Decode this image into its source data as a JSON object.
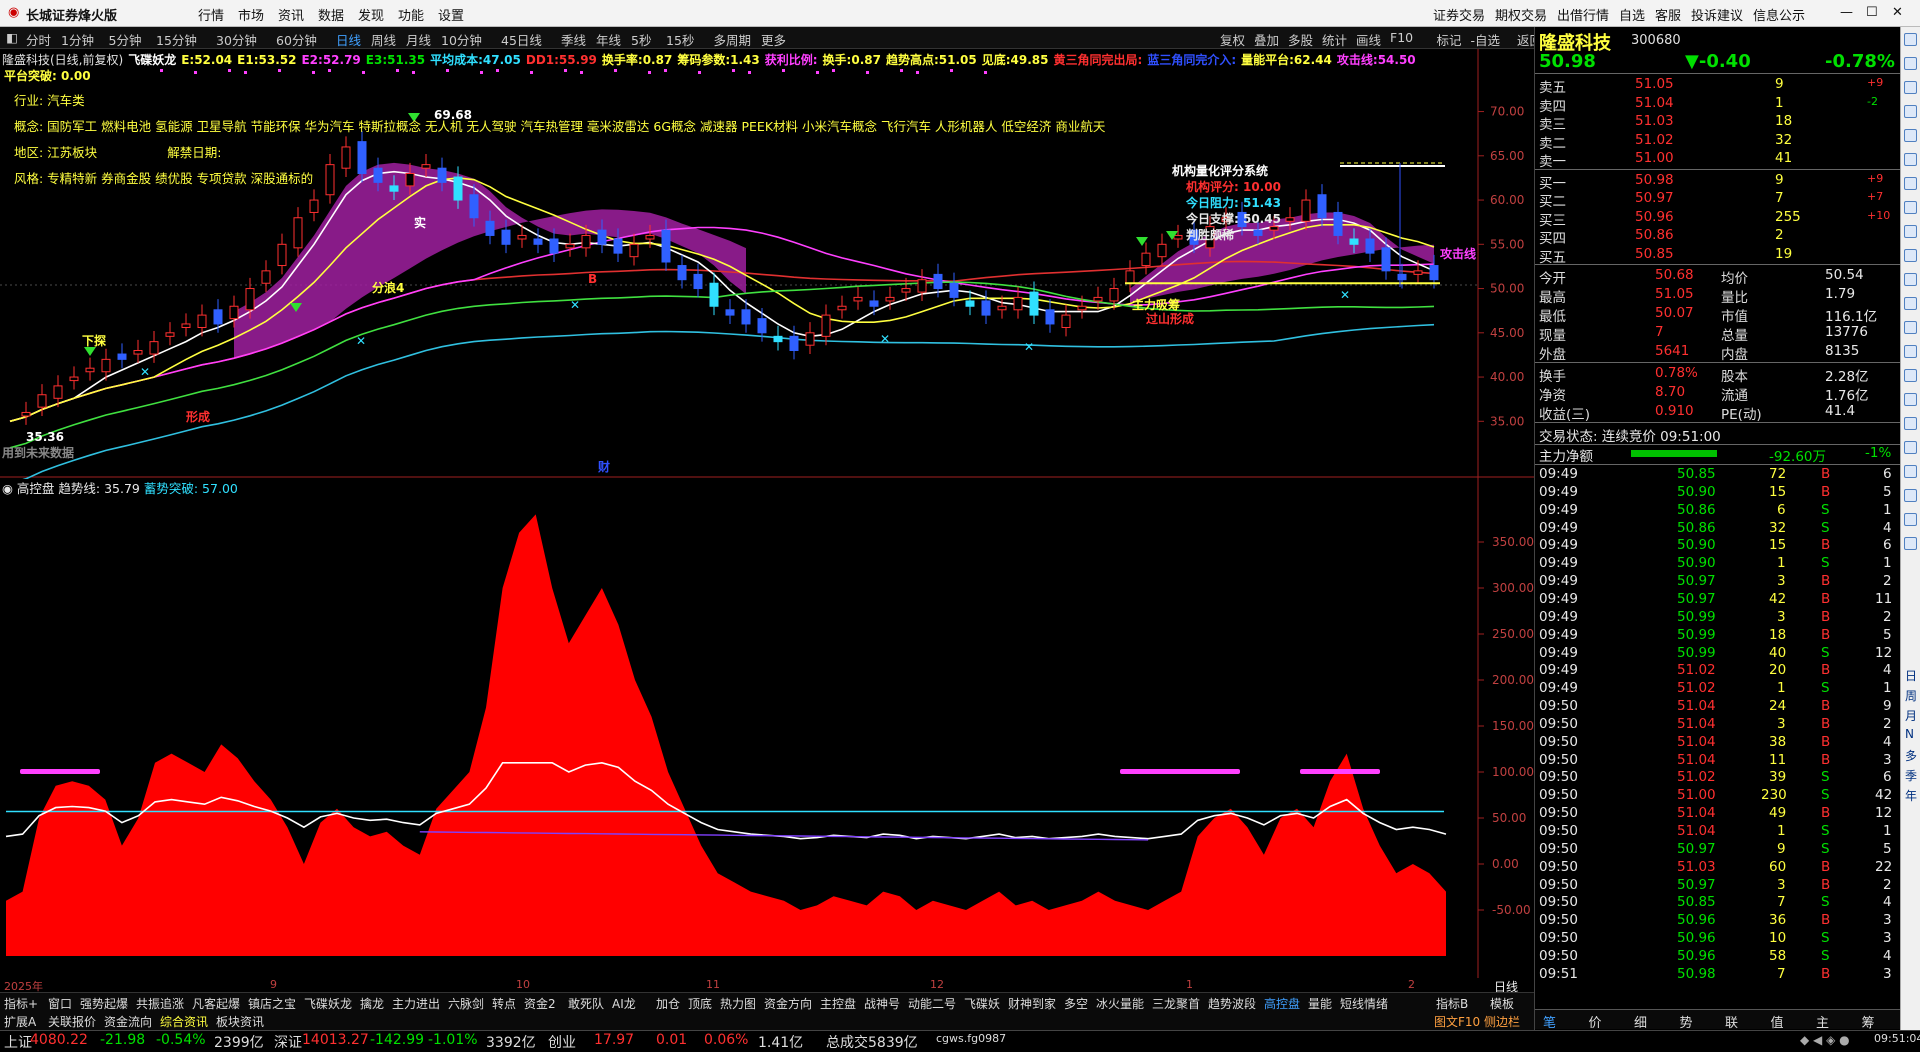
{
  "app": {
    "title": "长城证券烽火版",
    "menus": [
      "行情",
      "市场",
      "资讯",
      "数据",
      "发现",
      "功能",
      "设置"
    ],
    "right_menus": [
      "证券交易",
      "期权交易",
      "出借行情",
      "自选",
      "客服",
      "投诉建议",
      "信息公示"
    ]
  },
  "periods": [
    "分时",
    "1分钟",
    "5分钟",
    "15分钟",
    "30分钟",
    "60分钟",
    "日线",
    "周线",
    "月线",
    "10分钟",
    "45日线",
    "季线",
    "年线",
    "5秒",
    "15秒",
    "多周期",
    "更多"
  ],
  "active_period": "日线",
  "right_tools": [
    "复权",
    "叠加",
    "多股",
    "统计",
    "画线",
    "F10",
    "标记",
    "-自选",
    "返回"
  ],
  "main_header": {
    "line1": [
      {
        "t": "隆盛科技(日线,前复权)",
        "c": "#e0e0e0"
      },
      {
        "t": "飞碟妖龙",
        "c": "#ffffff"
      },
      {
        "t": "E:52.04",
        "c": "#ffff40"
      },
      {
        "t": "E1:53.52",
        "c": "#ffff40"
      },
      {
        "t": "E2:52.79",
        "c": "#ff40ff"
      },
      {
        "t": "E3:51.35",
        "c": "#00e000"
      },
      {
        "t": "平均成本:47.05",
        "c": "#30e0ff"
      },
      {
        "t": "DD1:55.99",
        "c": "#ff3030"
      },
      {
        "t": "换手率:0.87",
        "c": "#ffff40"
      },
      {
        "t": "筹码参数:1.43",
        "c": "#ffff40"
      },
      {
        "t": "获利比例:",
        "c": "#ff40ff"
      },
      {
        "t": "换手:0.87",
        "c": "#ffff40"
      },
      {
        "t": "趋势高点:51.05",
        "c": "#ffff40"
      },
      {
        "t": "见底:49.85",
        "c": "#ffff40"
      },
      {
        "t": "黄三角同完出局:",
        "c": "#ff3030"
      },
      {
        "t": "蓝三角同完介入:",
        "c": "#3050ff"
      },
      {
        "t": "量能平台:62.44",
        "c": "#ffff40"
      },
      {
        "t": "攻击线:54.50",
        "c": "#ff40ff"
      }
    ],
    "line2": "平台突破: 0.00"
  },
  "info": {
    "industry": "行业: 汽车类",
    "concept": "概念: 国防军工 燃料电池 氢能源 卫星导航 节能环保 华为汽车 特斯拉概念 无人机 无人驾驶 汽车热管理 毫米波雷达 6G概念 减速器 PEEK材料 小米汽车概念 飞行汽车 人形机器人 低空经济 商业航天",
    "region": "地区: 江苏板块",
    "unban": "解禁日期:",
    "style": "风格: 专精特新 券商金股 绩优股 专项贷款 深股通标的"
  },
  "chart_labels": {
    "high": "69.68",
    "low": "35.36",
    "future": "用到未来数据",
    "cai": "财",
    "attack": "攻击线",
    "box_title": "机构量化评分系统",
    "box_score": "机构评分: 10.00",
    "box_res": "今日阻力: 51.43",
    "box_sup": "今日支撑: 50.45",
    "box_judge": "判胜颇稀",
    "zhuli": "主力吸筹",
    "guoshan": "过山形成",
    "fenlang": "分浪4",
    "yi1": "形成",
    "buy_b": "B",
    "xiapo": "下探",
    "shi": "实"
  },
  "ind_header": {
    "name": "高控盘",
    "trend": "趋势线: 35.79",
    "breakout": "蓄势突破: 57.00"
  },
  "price_axis": [
    "70.00",
    "65.00",
    "60.00",
    "55.00",
    "50.00",
    "45.00",
    "40.00",
    "35.00"
  ],
  "ind_axis": [
    "350.00",
    "300.00",
    "250.00",
    "200.00",
    "150.00",
    "100.00",
    "50.00",
    "0.00",
    "-50.00"
  ],
  "date_labels": [
    "2025年",
    "9",
    "10",
    "11",
    "12",
    "1",
    "2"
  ],
  "period_label": "日线",
  "bottom_tabs": [
    "指标+",
    "窗口",
    "强势起爆",
    "共振追涨",
    "凡客起爆",
    "镇店之宝",
    "飞碟妖龙",
    "擒龙",
    "主力进出",
    "六脉剑",
    "转点",
    "资金2",
    "敢死队",
    "AI龙",
    "加仓",
    "顶底",
    "热力图",
    "资金方向",
    "主控盘",
    "战神号",
    "动能二号",
    "飞碟妖",
    "财神到家",
    "多空",
    "冰火量能",
    "三龙聚首",
    "趋势波段",
    "高控盘",
    "量能",
    "短线情绪"
  ],
  "bottom_tabs2": [
    "扩展A",
    "关联报价",
    "资金流向",
    "综合资讯",
    "板块资讯"
  ],
  "bottom_right": [
    "指标B",
    "模板",
    "图文F10 侧边栏"
  ],
  "quote": {
    "name": "隆盛科技",
    "code": "300680",
    "price": "50.98",
    "change": "▼-0.40",
    "pct": "-0.78%",
    "asks": [
      [
        "卖五",
        "51.05",
        "9",
        "+9"
      ],
      [
        "卖四",
        "51.04",
        "1",
        "-2"
      ],
      [
        "卖三",
        "51.03",
        "18",
        ""
      ],
      [
        "卖二",
        "51.02",
        "32",
        ""
      ],
      [
        "卖一",
        "51.00",
        "41",
        ""
      ]
    ],
    "bids": [
      [
        "买一",
        "50.98",
        "9",
        "+9"
      ],
      [
        "买二",
        "50.97",
        "7",
        "+7"
      ],
      [
        "买三",
        "50.96",
        "255",
        "+10"
      ],
      [
        "买四",
        "50.86",
        "2",
        ""
      ],
      [
        "买五",
        "50.85",
        "19",
        ""
      ]
    ],
    "stats": [
      [
        "今开",
        "50.68",
        "均价",
        "50.54"
      ],
      [
        "最高",
        "51.05",
        "量比",
        "1.79"
      ],
      [
        "最低",
        "50.07",
        "市值",
        "116.1亿"
      ],
      [
        "现量",
        "7",
        "总量",
        "13776"
      ],
      [
        "外盘",
        "5641",
        "内盘",
        "8135"
      ]
    ],
    "stats2": [
      [
        "换手",
        "0.78%",
        "股本",
        "2.28亿"
      ],
      [
        "净资",
        "8.70",
        "流通",
        "1.76亿"
      ],
      [
        "收益(三)",
        "0.910",
        "PE(动)",
        "41.4"
      ]
    ],
    "state": "交易状态: 连续竞价 09:51:00",
    "flow_label": "主力净额",
    "flow_val": "-92.60万",
    "flow_pct": "-1%"
  },
  "ticks": [
    [
      "09:49",
      "50.85",
      "72",
      "B",
      "6"
    ],
    [
      "09:49",
      "50.90",
      "15",
      "B",
      "5"
    ],
    [
      "09:49",
      "50.86",
      "6",
      "S",
      "1"
    ],
    [
      "09:49",
      "50.86",
      "32",
      "S",
      "4"
    ],
    [
      "09:49",
      "50.90",
      "15",
      "B",
      "6"
    ],
    [
      "09:49",
      "50.90",
      "1",
      "S",
      "1"
    ],
    [
      "09:49",
      "50.97",
      "3",
      "B",
      "2"
    ],
    [
      "09:49",
      "50.97",
      "42",
      "B",
      "11"
    ],
    [
      "09:49",
      "50.99",
      "3",
      "B",
      "2"
    ],
    [
      "09:49",
      "50.99",
      "18",
      "B",
      "5"
    ],
    [
      "09:49",
      "50.99",
      "40",
      "S",
      "12"
    ],
    [
      "09:49",
      "51.02",
      "20",
      "B",
      "4"
    ],
    [
      "09:49",
      "51.02",
      "1",
      "S",
      "1"
    ],
    [
      "09:50",
      "51.04",
      "24",
      "B",
      "9"
    ],
    [
      "09:50",
      "51.04",
      "3",
      "B",
      "2"
    ],
    [
      "09:50",
      "51.04",
      "38",
      "B",
      "4"
    ],
    [
      "09:50",
      "51.04",
      "11",
      "B",
      "3"
    ],
    [
      "09:50",
      "51.02",
      "39",
      "S",
      "6"
    ],
    [
      "09:50",
      "51.00",
      "230",
      "S",
      "42"
    ],
    [
      "09:50",
      "51.04",
      "49",
      "B",
      "12"
    ],
    [
      "09:50",
      "51.04",
      "1",
      "S",
      "1"
    ],
    [
      "09:50",
      "50.97",
      "9",
      "S",
      "5"
    ],
    [
      "09:50",
      "51.03",
      "60",
      "B",
      "22"
    ],
    [
      "09:50",
      "50.97",
      "3",
      "B",
      "2"
    ],
    [
      "09:50",
      "50.85",
      "7",
      "S",
      "4"
    ],
    [
      "09:50",
      "50.96",
      "36",
      "B",
      "3"
    ],
    [
      "09:50",
      "50.96",
      "10",
      "S",
      "3"
    ],
    [
      "09:50",
      "50.96",
      "58",
      "S",
      "4"
    ],
    [
      "09:51",
      "50.98",
      "7",
      "B",
      "3"
    ]
  ],
  "rp_tabs": [
    "笔",
    "价",
    "细",
    "势",
    "联",
    "值",
    "主",
    "筹"
  ],
  "status": {
    "sh_label": "上证",
    "sh": "4080.22",
    "sh_chg": "-21.98",
    "sh_pct": "-0.54%",
    "sh_amt": "2399亿",
    "sz_label": "深证",
    "sz": "14013.27",
    "sz_chg": "-142.99",
    "sz_pct": "-1.01%",
    "sz_amt": "3392亿",
    "cy_label": "创业",
    "cy": "17.97",
    "cy_chg": "0.01",
    "cy_pct": "0.06%",
    "cy_amt": "1.41亿",
    "total": "总成交5839亿",
    "server": "cgws.fg0987",
    "clock": "09:51:04"
  },
  "sidebar_chars": [
    "日",
    "周",
    "月",
    "N",
    "多",
    "季",
    "年"
  ],
  "chart_data": {
    "type": "candlestick",
    "price_range": [
      33,
      73
    ],
    "indicator_range": [
      -100,
      400
    ],
    "indicator_series": {
      "name": "高控盘",
      "values": [
        -40,
        -30,
        50,
        85,
        90,
        85,
        70,
        20,
        50,
        110,
        120,
        110,
        100,
        130,
        115,
        90,
        70,
        40,
        0,
        45,
        60,
        40,
        30,
        35,
        20,
        10,
        60,
        80,
        100,
        170,
        300,
        360,
        380,
        300,
        240,
        270,
        300,
        260,
        200,
        160,
        100,
        60,
        20,
        -10,
        -20,
        -30,
        -35,
        -40,
        -50,
        -45,
        -35,
        -40,
        -45,
        -30,
        -35,
        -50,
        -40,
        -45,
        -50,
        -40,
        -30,
        -45,
        -40,
        -50,
        -45,
        -40,
        -30,
        -40,
        -45,
        -50,
        -40,
        -30,
        30,
        50,
        60,
        40,
        10,
        50,
        60,
        40,
        90,
        120,
        60,
        20,
        -10,
        0,
        -10,
        -30
      ]
    }
  }
}
